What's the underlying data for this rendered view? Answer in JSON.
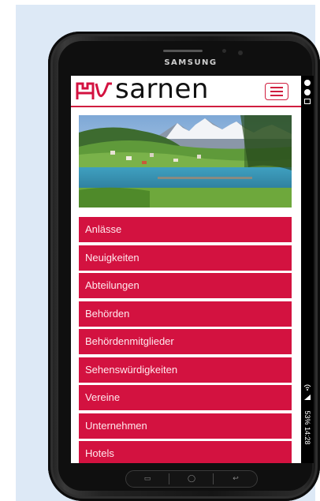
{
  "device": {
    "brand": "SAMSUNG"
  },
  "site": {
    "logo_text": "sarnen",
    "brand_color": "#d31240",
    "menu_icon": "hamburger-menu-icon"
  },
  "nav": {
    "items": [
      {
        "label": "Anlässe"
      },
      {
        "label": "Neuigkeiten"
      },
      {
        "label": "Abteilungen"
      },
      {
        "label": "Behörden"
      },
      {
        "label": "Behördenmitglieder"
      },
      {
        "label": "Sehenswürdigkeiten"
      },
      {
        "label": "Vereine"
      },
      {
        "label": "Unternehmen"
      },
      {
        "label": "Hotels"
      }
    ]
  },
  "status": {
    "text": "53% 14:28",
    "icons": [
      "alarm-icon",
      "notification-icon",
      "gallery-icon",
      "wifi-icon",
      "signal-icon",
      "battery-icon"
    ]
  },
  "android_nav": {
    "recent_icon": "recent-apps-icon",
    "home_icon": "home-icon",
    "back_icon": "back-icon"
  }
}
